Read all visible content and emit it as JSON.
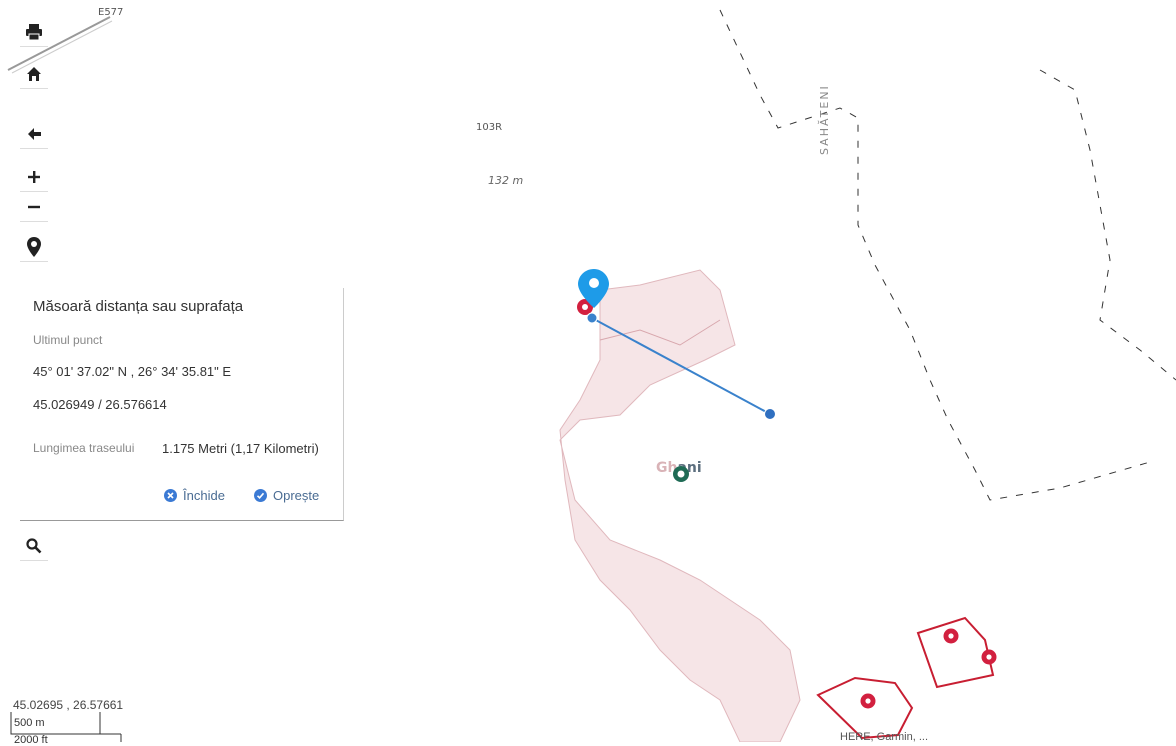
{
  "map": {
    "labels": {
      "road": "E577",
      "route": "103R",
      "elevation": "132 m",
      "locality": "SAHĂTENI",
      "town_faded": "Gh",
      "town_rest": "ani"
    },
    "colors": {
      "measure_line": "#3a82cc",
      "marker_blue": "#1e9be8",
      "marker_red": "#d2203f",
      "parcel_red": "#c81e32",
      "built_area": "#f3dcdf",
      "boundary": "#333333"
    }
  },
  "toolbar": {
    "icons": [
      "print-icon",
      "home-icon",
      "back-arrow-icon",
      "zoom-in-icon",
      "zoom-out-icon",
      "location-pin-icon",
      "search-icon"
    ]
  },
  "measure": {
    "title": "Măsoară distanța sau suprafața",
    "subtitle": "Ultimul punct",
    "dms": "45° 01' 37.02\" N , 26° 34' 35.81\" E",
    "decimal": "45.026949 / 26.576614",
    "length_label": "Lungimea traseului",
    "length_value": "1.175 Metri (1,17 Kilometri)",
    "close_label": "Închide",
    "stop_label": "Oprește"
  },
  "footer": {
    "coords": "45.02695 , 26.57661",
    "scale_metric": "500 m",
    "scale_imperial": "2000 ft",
    "attribution": "HERE, Garmin, ..."
  }
}
